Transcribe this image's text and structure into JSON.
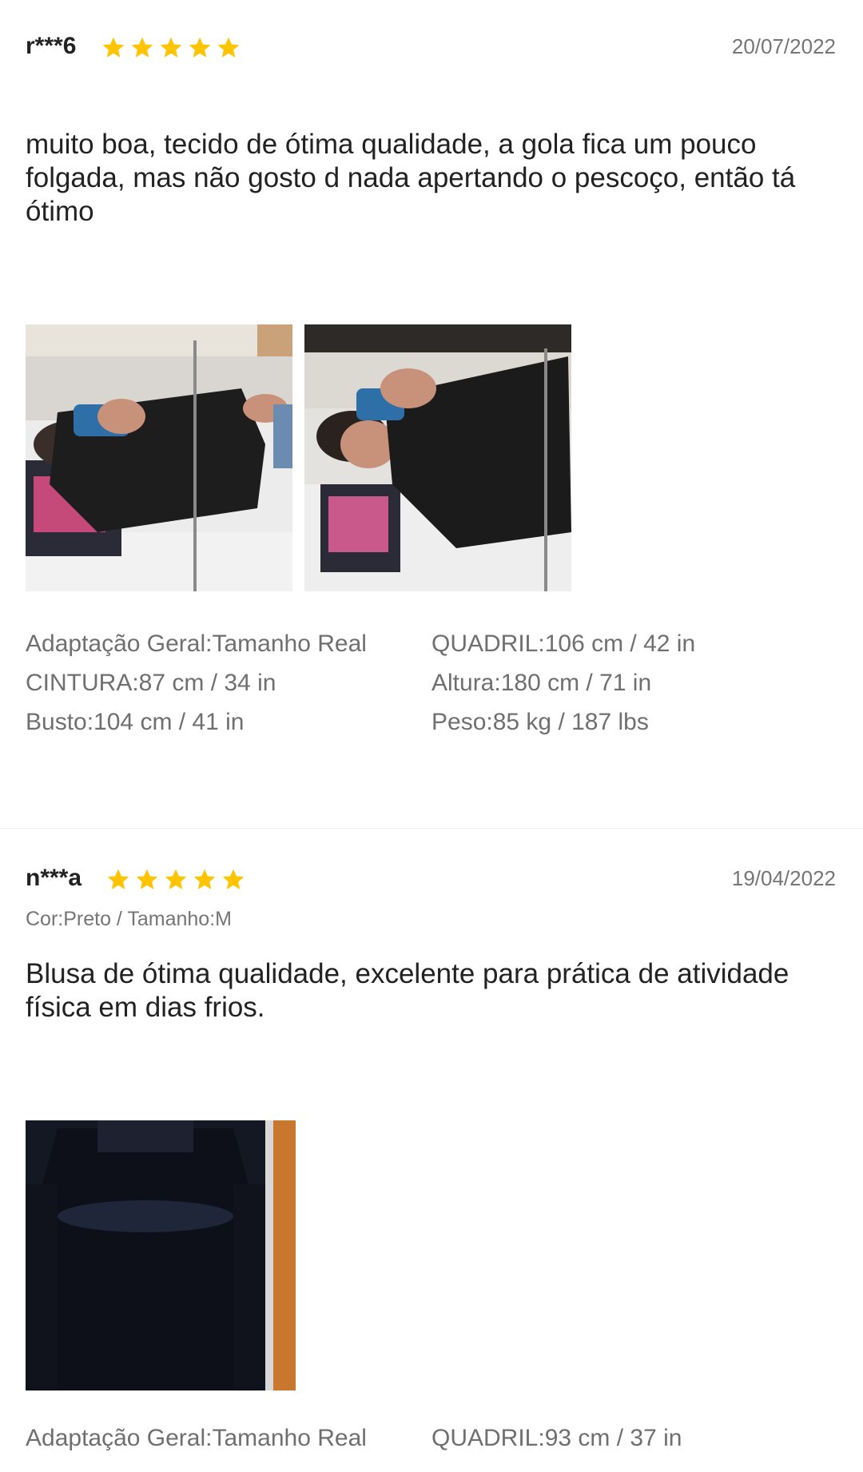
{
  "reviews": [
    {
      "username": "r***6",
      "rating": 5,
      "date": "20/07/2022",
      "text": "muito boa, tecido de ótima qualidade, a gola fica um pouco folgada, mas não gosto d nada apertando o pescoço, então tá ótimo",
      "photos": [
        {
          "description_icon": "review-photo"
        },
        {
          "description_icon": "review-photo"
        }
      ],
      "attributes": [
        "Adaptação Geral:Tamanho Real",
        "QUADRIL:106 cm / 42 in",
        "CINTURA:87 cm / 34 in",
        "Altura:180 cm / 71 in",
        "Busto:104 cm / 41 in",
        "Peso:85 kg / 187 lbs"
      ]
    },
    {
      "username": "n***a",
      "rating": 5,
      "date": "19/04/2022",
      "variant": "Cor:Preto / Tamanho:M",
      "text": "Blusa de ótima qualidade, excelente para prática de atividade física em dias frios.",
      "photos": [
        {
          "description_icon": "review-photo"
        }
      ],
      "attributes": [
        "Adaptação Geral:Tamanho Real",
        "QUADRIL:93 cm / 37 in"
      ]
    }
  ],
  "colors": {
    "star": "#FFC400",
    "text_primary": "#222222",
    "text_secondary": "#757575",
    "divider": "#EEEEEE"
  }
}
